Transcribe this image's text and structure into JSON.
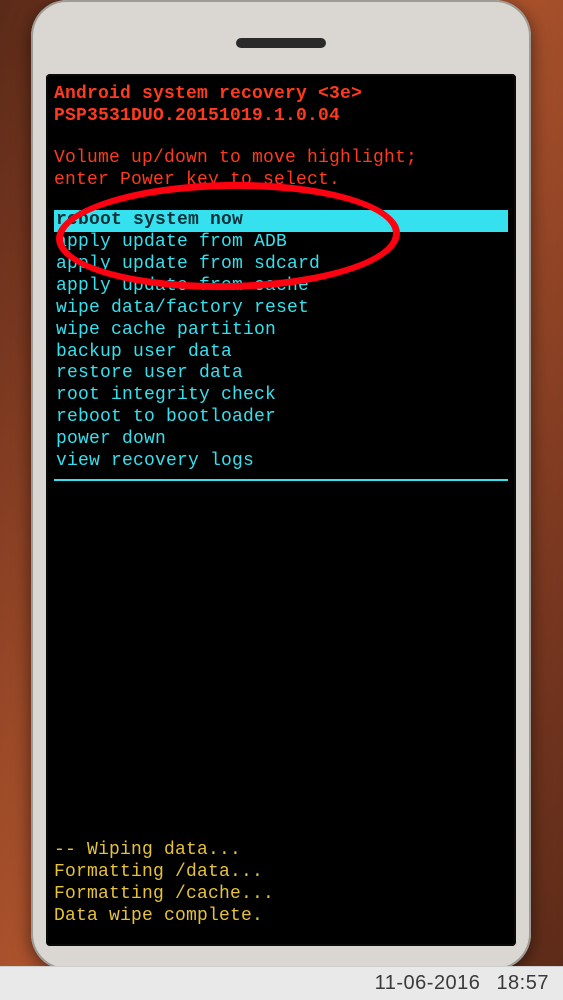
{
  "header": {
    "title": "Android system recovery <3e>",
    "build": "PSP3531DUO.20151019.1.0.04"
  },
  "instructions": {
    "line1": "Volume up/down to move highlight;",
    "line2": "enter Power key to select."
  },
  "menu": {
    "items": [
      {
        "label": "reboot system now",
        "selected": true
      },
      {
        "label": "apply update from ADB",
        "selected": false
      },
      {
        "label": "apply update from sdcard",
        "selected": false
      },
      {
        "label": "apply update from cache",
        "selected": false
      },
      {
        "label": "wipe data/factory reset",
        "selected": false
      },
      {
        "label": "wipe cache partition",
        "selected": false
      },
      {
        "label": "backup user data",
        "selected": false
      },
      {
        "label": "restore user data",
        "selected": false
      },
      {
        "label": "root integrity check",
        "selected": false
      },
      {
        "label": "reboot to bootloader",
        "selected": false
      },
      {
        "label": "power down",
        "selected": false
      },
      {
        "label": "view recovery logs",
        "selected": false
      }
    ]
  },
  "log": {
    "l0": "-- Wiping data...",
    "l1": "Formatting /data...",
    "l2": "Formatting /cache...",
    "l3": "Data wipe complete."
  },
  "timestamp": {
    "date": "11-06-2016",
    "time": "18:57"
  },
  "annotation": {
    "circle_stroke": "#ff0010"
  }
}
